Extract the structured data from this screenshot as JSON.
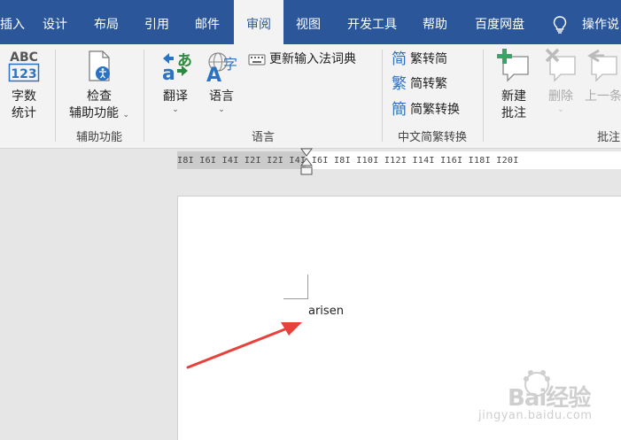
{
  "tabs": {
    "insert": "插入",
    "design": "设计",
    "layout": "布局",
    "references": "引用",
    "mailings": "邮件",
    "review": "审阅",
    "view": "视图",
    "developer": "开发工具",
    "help": "帮助",
    "baidu": "百度网盘",
    "tell_me": "操作说"
  },
  "ribbon": {
    "proofing": {
      "word_count_icon_top": "ABC",
      "word_count_icon_bottom": "123",
      "word_count_line1": "字数",
      "word_count_line2": "统计"
    },
    "accessibility": {
      "check_line1": "检查",
      "check_line2": "辅助功能",
      "group_label": "辅助功能"
    },
    "language": {
      "translate": "翻译",
      "language": "语言",
      "update_ime": "更新输入法词典",
      "group_label": "语言"
    },
    "chinese_conversion": {
      "trad_to_simp": "繁转简",
      "simp_to_trad": "简转繁",
      "convert": "简繁转换",
      "group_label": "中文简繁转换"
    },
    "comments": {
      "new_line1": "新建",
      "new_line2": "批注",
      "delete": "删除",
      "previous": "上一条",
      "group_label": "批注"
    }
  },
  "ruler": {
    "text": "I8I  I6I  I4I  I2I        I2I  I4I  I6I  I8I  I10I  I12I  I14I  I16I  I18I  I20I"
  },
  "document": {
    "text": "arisen"
  },
  "watermark": {
    "brand": "Bai经验",
    "site": "jingyan.baidu.com"
  },
  "colors": {
    "tab_bar": "#2b579a",
    "ribbon": "#f3f3f3",
    "arrow": "#e8413c"
  }
}
